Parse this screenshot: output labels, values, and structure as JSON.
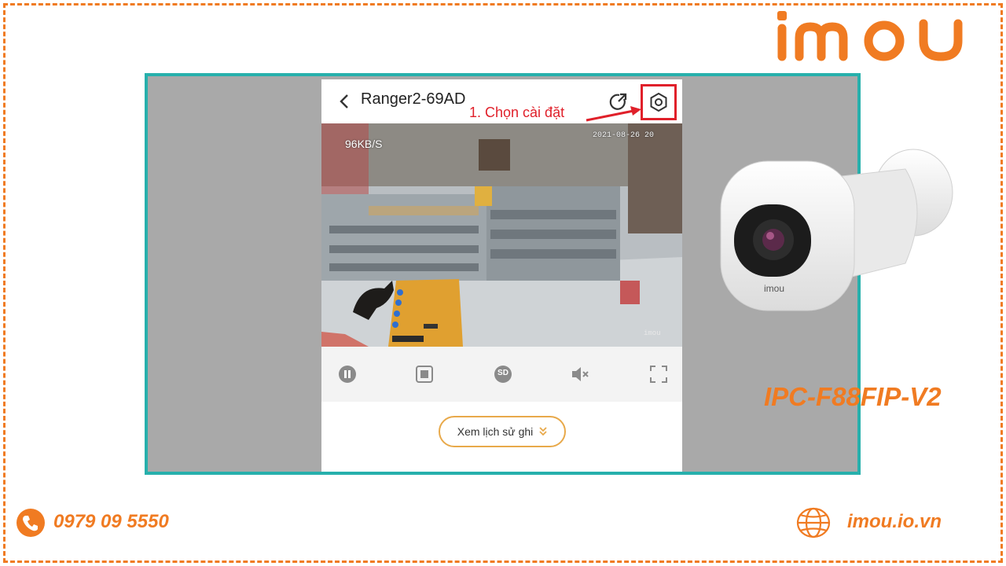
{
  "brand": {
    "logo_text": "imou"
  },
  "app": {
    "device_name": "Ranger2-69AD",
    "annotation": "1. Chọn cài đặt",
    "video": {
      "bitrate": "96KB/S",
      "timestamp": "2021-08-26 20",
      "watermark": "imou"
    },
    "controls": [
      "pause-icon",
      "screenshot-icon",
      "sd-quality-icon",
      "mute-icon",
      "fullscreen-icon"
    ],
    "controls_sd_label": "SD",
    "history_button": "Xem lịch sử ghi"
  },
  "product": {
    "model": "IPC-F88FIP-V2",
    "camera_label": "imou"
  },
  "footer": {
    "phone": "0979 09 5550",
    "website": "imou.io.vn"
  },
  "colors": {
    "accent_orange": "#f07b22",
    "frame_teal": "#27b0ac",
    "highlight_red": "#e0202a",
    "button_gold": "#e8a94a"
  }
}
